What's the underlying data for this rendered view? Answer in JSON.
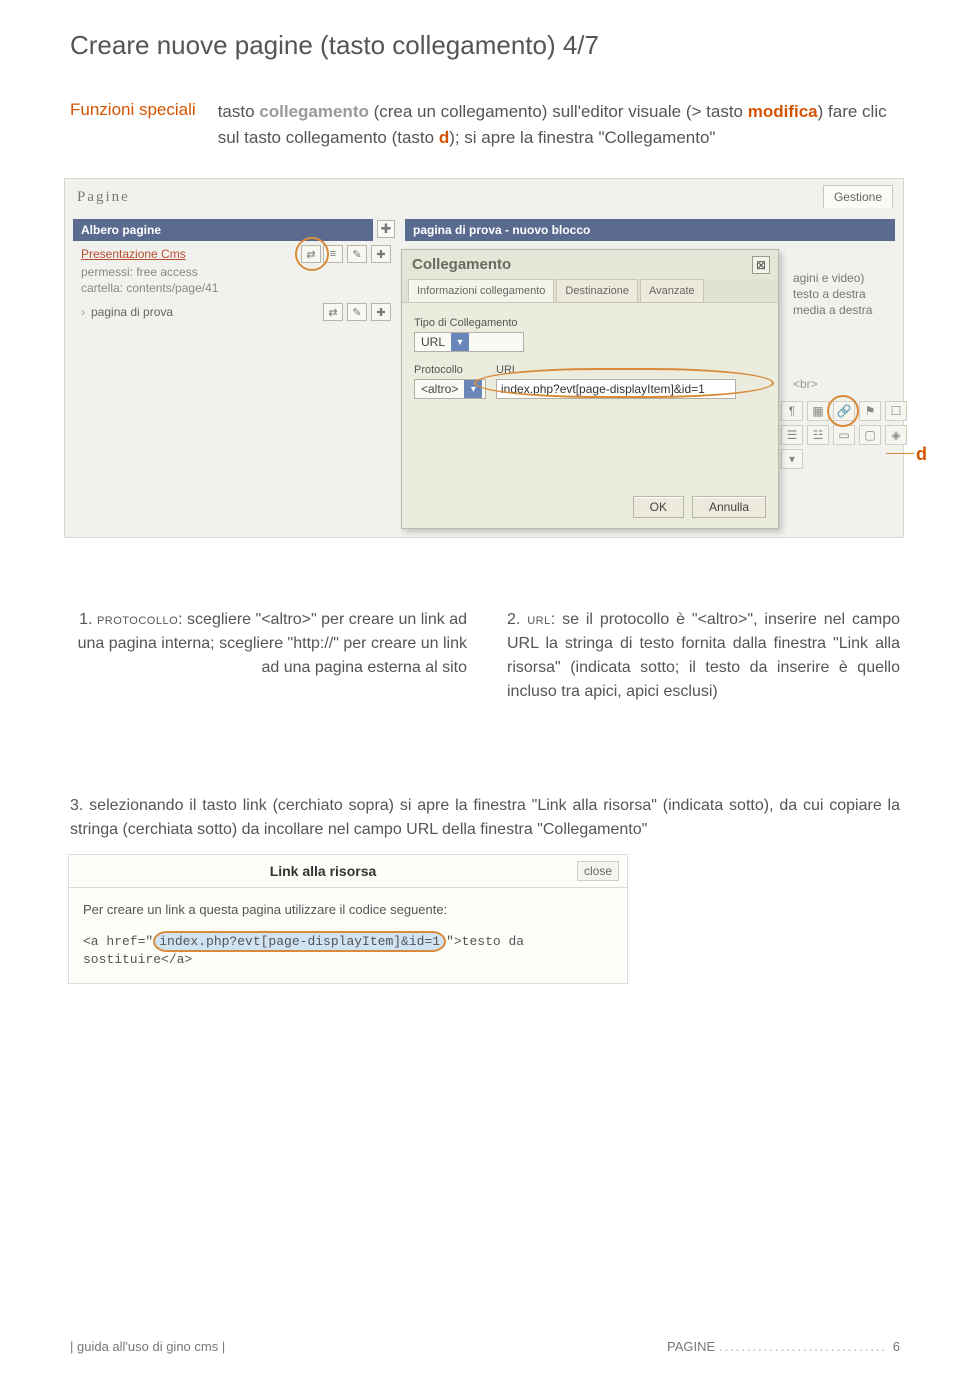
{
  "title": "Creare nuove pagine (tasto collegamento) 4/7",
  "func_label": "Funzioni speciali",
  "intro": {
    "pre": "tasto ",
    "kw1": "collegamento",
    "mid1": " (crea un collegamento)\nsull'editor visuale (> tasto ",
    "kw2": "modifica",
    "mid2": ") fare clic sul tasto collegamento (tasto ",
    "kw3": "d",
    "post": "); si apre la finestra \"Collegamento\""
  },
  "shot1": {
    "pagine": "Pagine",
    "gestione": "Gestione",
    "albero": "Albero pagine",
    "main_hdr": "pagina di prova - nuovo blocco",
    "cms": "Presentazione Cms",
    "perm": "permessi: free access",
    "cart": "cartella: contents/page/41",
    "prova": "pagina di prova",
    "side1": "agini e video)",
    "side2": "testo a destra",
    "side3": "media a destra",
    "brtag": "<br>"
  },
  "dialog": {
    "title": "Collegamento",
    "tabs": [
      "Informazioni collegamento",
      "Destinazione",
      "Avanzate"
    ],
    "tipo_lbl": "Tipo di Collegamento",
    "tipo_val": "URL",
    "proto_lbl": "Protocollo",
    "proto_val": "<altro>",
    "url_lbl": "URL",
    "url_val": "index.php?evt[page-displayItem]&id=1",
    "ok": "OK",
    "annulla": "Annulla"
  },
  "d_marker": "d",
  "step1": {
    "pre": "1. ",
    "sc": "protocollo",
    "txt": ": scegliere \"<altro>\" per creare un link ad una pagina interna; scegliere \"http://\" per creare un link ad una pagina esterna al sito"
  },
  "step2": {
    "pre": "2. ",
    "sc": "url",
    "txt": ": se il protocollo è \"<altro>\", inserire nel campo URL la stringa di testo fornita dalla finestra \"Link alla risorsa\" (indicata sotto; il testo da inserire è quello incluso tra apici, apici esclusi)"
  },
  "step3": "3. selezionando il tasto link (cerchiato sopra) si apre la finestra \"Link alla risorsa\" (indicata sotto), da cui copiare la stringa (cerchiata sotto) da incollare nel campo URL della finestra \"Collegamento\"",
  "shot2": {
    "title": "Link alla risorsa",
    "close": "close",
    "desc": "Per creare un link a questa pagina utilizzare il codice seguente:",
    "code_pre": "<a href=\"",
    "code_hl": "index.php?evt[page-displayItem]&id=1",
    "code_post": "\">testo da sostituire</a>"
  },
  "footer": {
    "left": "| guida all'uso di gino cms |",
    "right_label": "PAGINE",
    "pg": "6"
  }
}
